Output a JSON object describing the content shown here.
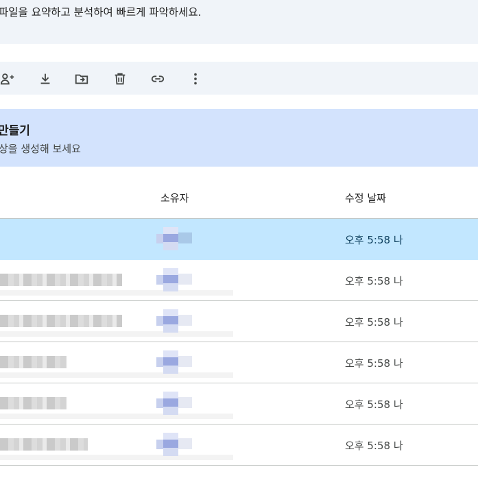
{
  "banner": {
    "text": "파일을 요약하고 분석하여 빠르게 파악하세요."
  },
  "toolbar": {
    "icons": [
      "share-icon",
      "download-icon",
      "move-icon",
      "delete-icon",
      "link-icon",
      "more-icon"
    ]
  },
  "promo": {
    "title": "만들기",
    "subtitle": "상을 생성해 보세요"
  },
  "table": {
    "headers": {
      "owner": "소유자",
      "modified": "수정 날짜"
    },
    "rows": [
      {
        "modified": "오후 5:58 나",
        "selected": true
      },
      {
        "modified": "오후 5:58 나",
        "selected": false
      },
      {
        "modified": "오후 5:58 나",
        "selected": false
      },
      {
        "modified": "오후 5:58 나",
        "selected": false
      },
      {
        "modified": "오후 5:58 나",
        "selected": false
      },
      {
        "modified": "오후 5:58 나",
        "selected": false
      }
    ]
  },
  "colors": {
    "banner_bg": "#f0f4f9",
    "promo_bg": "#d3e3fd",
    "selected_row": "#c2e7ff"
  }
}
